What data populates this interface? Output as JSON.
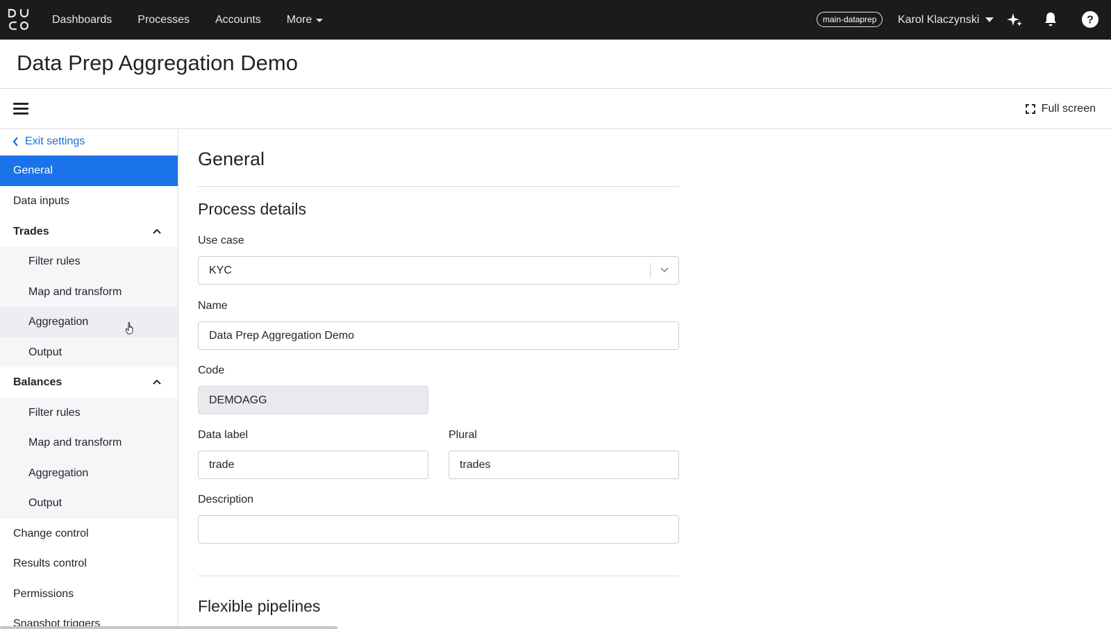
{
  "topbar": {
    "nav": [
      "Dashboards",
      "Processes",
      "Accounts",
      "More"
    ],
    "env_badge": "main-dataprep",
    "user_name": "Karol Klaczynski"
  },
  "page": {
    "title": "Data Prep Aggregation Demo"
  },
  "toolbar": {
    "fullscreen_label": "Full screen"
  },
  "sidebar": {
    "exit_label": "Exit settings",
    "items": {
      "general": "General",
      "data_inputs": "Data inputs",
      "trades": "Trades",
      "trades_filter": "Filter rules",
      "trades_map": "Map and transform",
      "trades_agg": "Aggregation",
      "trades_output": "Output",
      "balances": "Balances",
      "bal_filter": "Filter rules",
      "bal_map": "Map and transform",
      "bal_agg": "Aggregation",
      "bal_output": "Output",
      "change_control": "Change control",
      "results_control": "Results control",
      "permissions": "Permissions",
      "snapshot_triggers": "Snapshot triggers"
    }
  },
  "main": {
    "section_title": "General",
    "process_details": "Process details",
    "use_case": {
      "label": "Use case",
      "value": "KYC"
    },
    "name": {
      "label": "Name",
      "value": "Data Prep Aggregation Demo"
    },
    "code": {
      "label": "Code",
      "value": "DEMOAGG"
    },
    "data_label": {
      "label": "Data label",
      "value": "trade"
    },
    "plural": {
      "label": "Plural",
      "value": "trades"
    },
    "description": {
      "label": "Description",
      "value": ""
    },
    "flexible_pipelines": "Flexible pipelines"
  }
}
